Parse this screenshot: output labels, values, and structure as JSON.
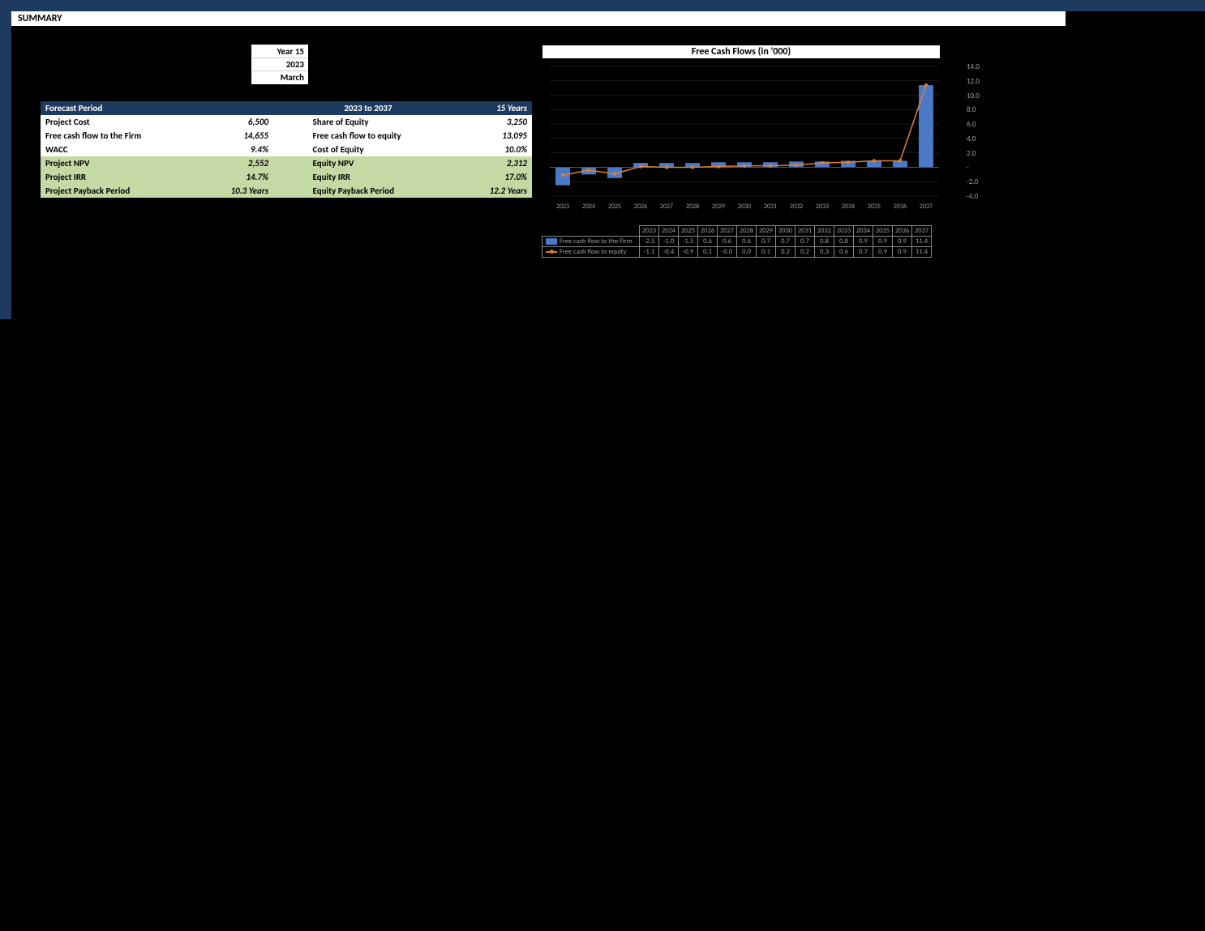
{
  "header": {
    "title": "SUMMARY"
  },
  "assumptions": {
    "year_label": "Year 15",
    "year_value": "2023",
    "month": "March"
  },
  "summary": {
    "forecast_period": {
      "label": "Forecast Period",
      "center": "2023 to 2037",
      "right": "15 Years"
    },
    "project_cost": {
      "label": "Project Cost",
      "value": "6,500"
    },
    "share_of_equity": {
      "label": "Share of Equity",
      "value": "3,250"
    },
    "fcf_firm": {
      "label": "Free cash flow to the Firm",
      "value": "14,655"
    },
    "fcf_equity": {
      "label": "Free cash flow to equity",
      "value": "13,095"
    },
    "wacc": {
      "label": "WACC",
      "value": "9.4%"
    },
    "cost_of_equity": {
      "label": "Cost of Equity",
      "value": "10.0%"
    },
    "project_npv": {
      "label": "Project NPV",
      "value": "2,552"
    },
    "equity_npv": {
      "label": "Equity NPV",
      "value": "2,312"
    },
    "project_irr": {
      "label": "Project IRR",
      "value": "14.7%"
    },
    "equity_irr": {
      "label": "Equity IRR",
      "value": "17.0%"
    },
    "project_payback": {
      "label": "Project Payback Period",
      "value": "10.3 Years"
    },
    "equity_payback": {
      "label": "Equity Payback Period",
      "value": "12.2 Years"
    }
  },
  "chart_data": {
    "type": "bar+line",
    "title": "Free Cash Flows (in '000)",
    "categories": [
      "2023",
      "2024",
      "2025",
      "2026",
      "2027",
      "2028",
      "2029",
      "2030",
      "2031",
      "2032",
      "2033",
      "2034",
      "2035",
      "2036",
      "2037"
    ],
    "ylim": [
      -4.0,
      14.0
    ],
    "yticks": [
      14.0,
      12.0,
      10.0,
      8.0,
      6.0,
      4.0,
      2.0,
      "-",
      -2.0,
      -4.0
    ],
    "series": [
      {
        "name": "Free cash flow to the Firm",
        "type": "bar",
        "color": "#4a7ac7",
        "values": [
          -2.5,
          -1.0,
          -1.5,
          0.6,
          0.6,
          0.6,
          0.7,
          0.7,
          0.7,
          0.8,
          0.8,
          0.9,
          0.9,
          0.9,
          11.4
        ]
      },
      {
        "name": "Free cash flow to equity",
        "type": "line",
        "color": "#d97f3a",
        "values": [
          -1.1,
          -0.4,
          -0.9,
          0.1,
          -0.0,
          0.0,
          0.1,
          0.2,
          0.2,
          0.3,
          0.6,
          0.7,
          0.9,
          0.9,
          11.4
        ]
      }
    ]
  }
}
